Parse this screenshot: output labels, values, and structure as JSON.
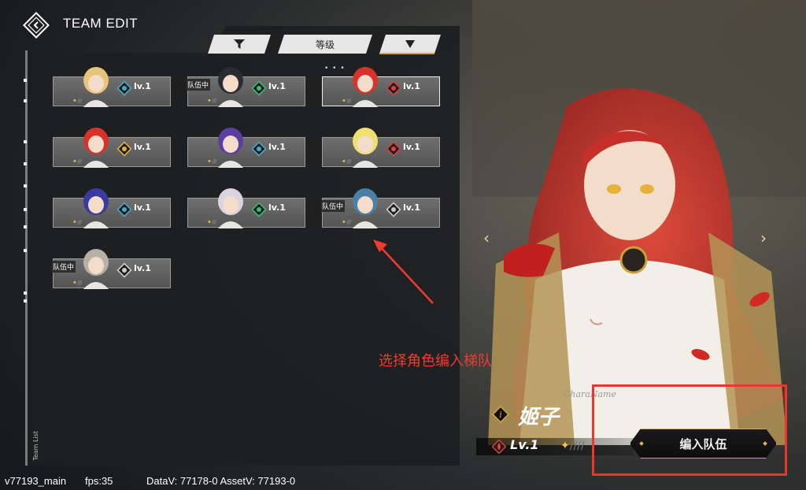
{
  "header": {
    "title": "TEAM EDIT",
    "back_icon": "back-diamond-icon"
  },
  "toolbar": {
    "sort_label": "等级",
    "filter_icon": "filter-funnel-icon",
    "order_icon": "triangle-down-icon"
  },
  "side": {
    "team_list_label": "Team List"
  },
  "roster": [
    {
      "level": "lv.1",
      "element": "ice",
      "badge": "",
      "color": "#4aa8c4"
    },
    {
      "level": "lv.1",
      "element": "wind",
      "badge": "队伍中",
      "color": "#3fb873"
    },
    {
      "level": "lv.1",
      "element": "fire",
      "badge": "",
      "color": "#d94040",
      "selected": true
    },
    {
      "level": "lv.1",
      "element": "lightning",
      "badge": "",
      "color": "#e0b13a"
    },
    {
      "level": "lv.1",
      "element": "ice",
      "badge": "",
      "color": "#4aa8c4"
    },
    {
      "level": "lv.1",
      "element": "fire",
      "badge": "",
      "color": "#d94040"
    },
    {
      "level": "lv.1",
      "element": "ice",
      "badge": "",
      "color": "#4aa8c4"
    },
    {
      "level": "lv.1",
      "element": "wind",
      "badge": "",
      "color": "#3fb873"
    },
    {
      "level": "lv.1",
      "element": "physical",
      "badge": "队伍中",
      "color": "#cccccc"
    },
    {
      "level": "lv.1",
      "element": "physical",
      "badge": "队伍中",
      "color": "#cccccc"
    }
  ],
  "character": {
    "name_tag": "CharaName",
    "name": "姬子",
    "level": "Lv.1",
    "element": "fire",
    "join_label": "编入队伍"
  },
  "annotation": {
    "text": "选择角色编入梯队"
  },
  "debug": {
    "build": "v77193_main",
    "fps": "fps:35",
    "versions": "DataV: 77178-0 AssetV: 77193-0"
  }
}
